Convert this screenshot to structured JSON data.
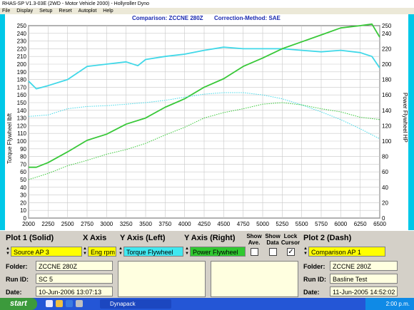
{
  "window": {
    "title": "RHAS-SP V1.3-03E  (2WD - Motor Vehicle 2000) - Hollyroller Dyno"
  },
  "menu": [
    "File",
    "Display",
    "Setup",
    "Reset",
    "Autoplot",
    "Help"
  ],
  "chart_header": {
    "comparison": "Comparison: ZCCNE 280Z",
    "correction": "Correction-Method: SAE"
  },
  "chart_data": {
    "type": "line",
    "xlabel": "",
    "ylabel": "Torque Flywheel lbft",
    "y2label": "Power Flywheel HP",
    "xlim": [
      2000,
      6500
    ],
    "ylim": [
      0,
      250
    ],
    "y2lim": [
      0,
      250
    ],
    "x_ticks": [
      2000,
      2250,
      2500,
      2750,
      3000,
      3250,
      3500,
      3750,
      4000,
      4250,
      4500,
      4750,
      5000,
      5250,
      5500,
      5750,
      6000,
      6250,
      6500
    ],
    "y_ticks": [
      0,
      10,
      20,
      30,
      40,
      50,
      60,
      70,
      80,
      90,
      100,
      110,
      120,
      130,
      140,
      150,
      160,
      170,
      180,
      190,
      200,
      210,
      220,
      230,
      240,
      250
    ],
    "y2_ticks": [
      0,
      20,
      40,
      60,
      80,
      100,
      120,
      140,
      160,
      180,
      200,
      220,
      240,
      250
    ],
    "colors": {
      "torque": "#40d8e8",
      "power": "#38c838"
    },
    "series": [
      {
        "name": "Torque Flywheel (Solid)",
        "style": "solid",
        "color": "#40d8e8",
        "x": [
          2000,
          2100,
          2250,
          2500,
          2750,
          3000,
          3250,
          3400,
          3500,
          3750,
          4000,
          4250,
          4500,
          4750,
          5000,
          5250,
          5500,
          5750,
          6000,
          6250,
          6400,
          6500
        ],
        "y": [
          178,
          168,
          172,
          180,
          197,
          200,
          203,
          198,
          206,
          210,
          213,
          218,
          222,
          220,
          220,
          220,
          218,
          216,
          218,
          215,
          210,
          195
        ]
      },
      {
        "name": "Power Flywheel (Solid)",
        "style": "solid",
        "color": "#38c838",
        "x": [
          2000,
          2100,
          2250,
          2500,
          2750,
          3000,
          3250,
          3500,
          3750,
          4000,
          4250,
          4500,
          4750,
          5000,
          5250,
          5500,
          5750,
          6000,
          6250,
          6400,
          6500
        ],
        "y": [
          66,
          66,
          72,
          86,
          101,
          109,
          122,
          130,
          144,
          155,
          170,
          181,
          197,
          208,
          220,
          229,
          238,
          247,
          250,
          252,
          235
        ]
      },
      {
        "name": "Torque Flywheel (Dash)",
        "style": "dash",
        "color": "#40d8e8",
        "x": [
          2000,
          2250,
          2500,
          2750,
          3000,
          3250,
          3500,
          3750,
          4000,
          4250,
          4500,
          4750,
          5000,
          5250,
          5500,
          5750,
          6000,
          6250,
          6500
        ],
        "y": [
          132,
          134,
          142,
          145,
          146,
          148,
          150,
          153,
          157,
          161,
          163,
          163,
          160,
          155,
          147,
          138,
          128,
          116,
          103
        ]
      },
      {
        "name": "Power Flywheel (Dash)",
        "style": "dash",
        "color": "#38c838",
        "x": [
          2000,
          2250,
          2500,
          2750,
          3000,
          3250,
          3500,
          3750,
          4000,
          4250,
          4500,
          4750,
          5000,
          5250,
          5500,
          5750,
          6000,
          6250,
          6500
        ],
        "y": [
          50,
          58,
          68,
          75,
          83,
          89,
          97,
          108,
          118,
          130,
          137,
          142,
          148,
          150,
          147,
          142,
          138,
          131,
          128
        ]
      }
    ]
  },
  "panel": {
    "plot1_header": "Plot 1 (Solid)",
    "xaxis_header": "X Axis",
    "yleft_header": "Y Axis (Left)",
    "yright_header": "Y Axis (Right)",
    "show_ave_label": "Show Ave.",
    "show_data_label": "Show Data",
    "lock_cursor_label": "Lock Cursor",
    "plot2_header": "Plot 2 (Dash)",
    "source_value": "Source AP 3",
    "xaxis_value": "Eng rpm",
    "yleft_value": "Torque Flywheel",
    "yright_value": "Power Flywheel",
    "plot2_value": "Comparison AP 1",
    "folder_label": "Folder:",
    "runid_label": "Run ID:",
    "date_label": "Date:",
    "plot1": {
      "folder": "ZCCNE 280Z",
      "run_id": "SC 5",
      "date": "10-Jun-2006  13:07:13"
    },
    "plot2": {
      "folder": "ZCCNE 280Z",
      "run_id": "Basline Test",
      "date": "11-Jun-2005  14:52:02"
    },
    "lock_cursor_checked": true
  },
  "taskbar": {
    "start_label": "start",
    "task_label": "Dynapack",
    "clock": "2:00 p.m."
  }
}
